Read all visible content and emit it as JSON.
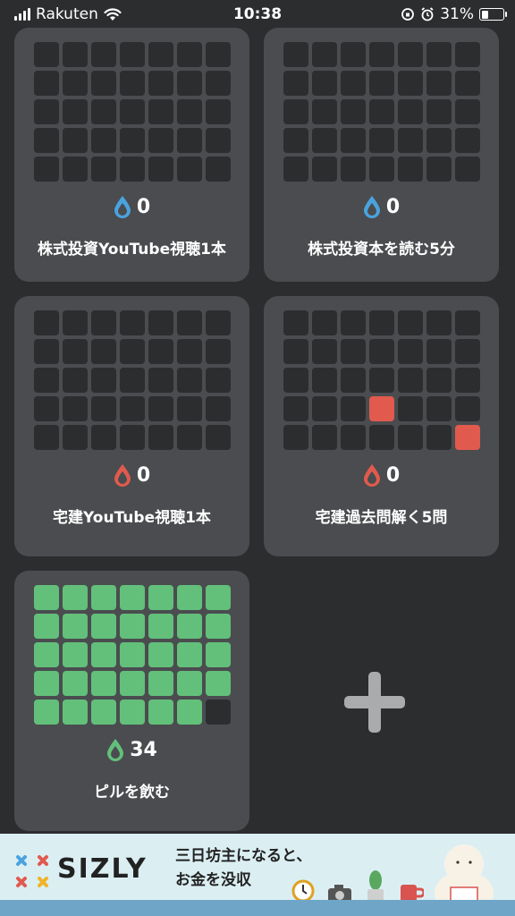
{
  "status_bar": {
    "carrier": "Rakuten",
    "time": "10:38",
    "battery_percent": "31%"
  },
  "habits": [
    {
      "count": "0",
      "label": "株式投資YouTube視聴1本",
      "drop_color": "#4aa3df",
      "filled_color": "#62c07a",
      "filled_cells": []
    },
    {
      "count": "0",
      "label": "株式投資本を読む5分",
      "drop_color": "#4aa3df",
      "filled_color": "#62c07a",
      "filled_cells": []
    },
    {
      "count": "0",
      "label": "宅建YouTube視聴1本",
      "drop_color": "#e15a4e",
      "filled_color": "#e15a4e",
      "filled_cells": []
    },
    {
      "count": "0",
      "label": "宅建過去問解く5問",
      "drop_color": "#e15a4e",
      "filled_color": "#e15a4e",
      "filled_cells": [
        24,
        34
      ]
    },
    {
      "count": "34",
      "label": "ピルを飲む",
      "drop_color": "#62c07a",
      "filled_color": "#62c07a",
      "filled_cells": [
        0,
        1,
        2,
        3,
        4,
        5,
        6,
        7,
        8,
        9,
        10,
        11,
        12,
        13,
        14,
        15,
        16,
        17,
        18,
        19,
        20,
        21,
        22,
        23,
        24,
        25,
        26,
        27,
        28,
        29,
        30,
        31,
        32,
        33
      ]
    }
  ],
  "ad": {
    "brand": "SIZLY",
    "line1": "三日坊主になると、",
    "line2": "お金を没収"
  },
  "colors": {
    "background": "#2b2d2f",
    "card": "#4a4c4f",
    "empty_cell": "#2b2d2f",
    "add_button": "#a9abad"
  }
}
